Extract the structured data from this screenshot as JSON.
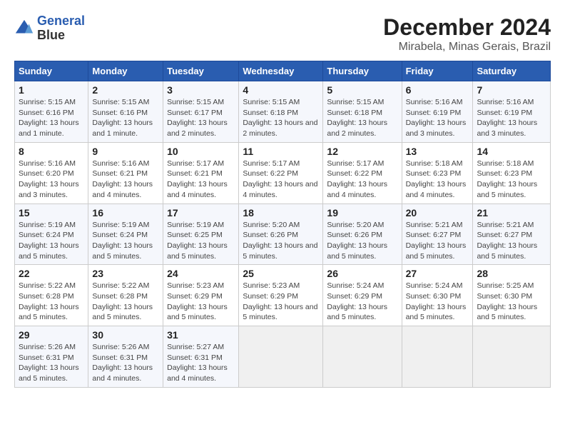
{
  "header": {
    "logo_line1": "General",
    "logo_line2": "Blue",
    "month_title": "December 2024",
    "location": "Mirabela, Minas Gerais, Brazil"
  },
  "weekdays": [
    "Sunday",
    "Monday",
    "Tuesday",
    "Wednesday",
    "Thursday",
    "Friday",
    "Saturday"
  ],
  "weeks": [
    [
      {
        "day": "1",
        "sunrise": "5:15 AM",
        "sunset": "6:16 PM",
        "daylight": "13 hours and 1 minute."
      },
      {
        "day": "2",
        "sunrise": "5:15 AM",
        "sunset": "6:16 PM",
        "daylight": "13 hours and 1 minute."
      },
      {
        "day": "3",
        "sunrise": "5:15 AM",
        "sunset": "6:17 PM",
        "daylight": "13 hours and 2 minutes."
      },
      {
        "day": "4",
        "sunrise": "5:15 AM",
        "sunset": "6:18 PM",
        "daylight": "13 hours and 2 minutes."
      },
      {
        "day": "5",
        "sunrise": "5:15 AM",
        "sunset": "6:18 PM",
        "daylight": "13 hours and 2 minutes."
      },
      {
        "day": "6",
        "sunrise": "5:16 AM",
        "sunset": "6:19 PM",
        "daylight": "13 hours and 3 minutes."
      },
      {
        "day": "7",
        "sunrise": "5:16 AM",
        "sunset": "6:19 PM",
        "daylight": "13 hours and 3 minutes."
      }
    ],
    [
      {
        "day": "8",
        "sunrise": "5:16 AM",
        "sunset": "6:20 PM",
        "daylight": "13 hours and 3 minutes."
      },
      {
        "day": "9",
        "sunrise": "5:16 AM",
        "sunset": "6:21 PM",
        "daylight": "13 hours and 4 minutes."
      },
      {
        "day": "10",
        "sunrise": "5:17 AM",
        "sunset": "6:21 PM",
        "daylight": "13 hours and 4 minutes."
      },
      {
        "day": "11",
        "sunrise": "5:17 AM",
        "sunset": "6:22 PM",
        "daylight": "13 hours and 4 minutes."
      },
      {
        "day": "12",
        "sunrise": "5:17 AM",
        "sunset": "6:22 PM",
        "daylight": "13 hours and 4 minutes."
      },
      {
        "day": "13",
        "sunrise": "5:18 AM",
        "sunset": "6:23 PM",
        "daylight": "13 hours and 4 minutes."
      },
      {
        "day": "14",
        "sunrise": "5:18 AM",
        "sunset": "6:23 PM",
        "daylight": "13 hours and 5 minutes."
      }
    ],
    [
      {
        "day": "15",
        "sunrise": "5:19 AM",
        "sunset": "6:24 PM",
        "daylight": "13 hours and 5 minutes."
      },
      {
        "day": "16",
        "sunrise": "5:19 AM",
        "sunset": "6:24 PM",
        "daylight": "13 hours and 5 minutes."
      },
      {
        "day": "17",
        "sunrise": "5:19 AM",
        "sunset": "6:25 PM",
        "daylight": "13 hours and 5 minutes."
      },
      {
        "day": "18",
        "sunrise": "5:20 AM",
        "sunset": "6:26 PM",
        "daylight": "13 hours and 5 minutes."
      },
      {
        "day": "19",
        "sunrise": "5:20 AM",
        "sunset": "6:26 PM",
        "daylight": "13 hours and 5 minutes."
      },
      {
        "day": "20",
        "sunrise": "5:21 AM",
        "sunset": "6:27 PM",
        "daylight": "13 hours and 5 minutes."
      },
      {
        "day": "21",
        "sunrise": "5:21 AM",
        "sunset": "6:27 PM",
        "daylight": "13 hours and 5 minutes."
      }
    ],
    [
      {
        "day": "22",
        "sunrise": "5:22 AM",
        "sunset": "6:28 PM",
        "daylight": "13 hours and 5 minutes."
      },
      {
        "day": "23",
        "sunrise": "5:22 AM",
        "sunset": "6:28 PM",
        "daylight": "13 hours and 5 minutes."
      },
      {
        "day": "24",
        "sunrise": "5:23 AM",
        "sunset": "6:29 PM",
        "daylight": "13 hours and 5 minutes."
      },
      {
        "day": "25",
        "sunrise": "5:23 AM",
        "sunset": "6:29 PM",
        "daylight": "13 hours and 5 minutes."
      },
      {
        "day": "26",
        "sunrise": "5:24 AM",
        "sunset": "6:29 PM",
        "daylight": "13 hours and 5 minutes."
      },
      {
        "day": "27",
        "sunrise": "5:24 AM",
        "sunset": "6:30 PM",
        "daylight": "13 hours and 5 minutes."
      },
      {
        "day": "28",
        "sunrise": "5:25 AM",
        "sunset": "6:30 PM",
        "daylight": "13 hours and 5 minutes."
      }
    ],
    [
      {
        "day": "29",
        "sunrise": "5:26 AM",
        "sunset": "6:31 PM",
        "daylight": "13 hours and 5 minutes."
      },
      {
        "day": "30",
        "sunrise": "5:26 AM",
        "sunset": "6:31 PM",
        "daylight": "13 hours and 4 minutes."
      },
      {
        "day": "31",
        "sunrise": "5:27 AM",
        "sunset": "6:31 PM",
        "daylight": "13 hours and 4 minutes."
      },
      null,
      null,
      null,
      null
    ]
  ],
  "labels": {
    "sunrise_prefix": "Sunrise: ",
    "sunset_prefix": "Sunset: ",
    "daylight_prefix": "Daylight: "
  }
}
